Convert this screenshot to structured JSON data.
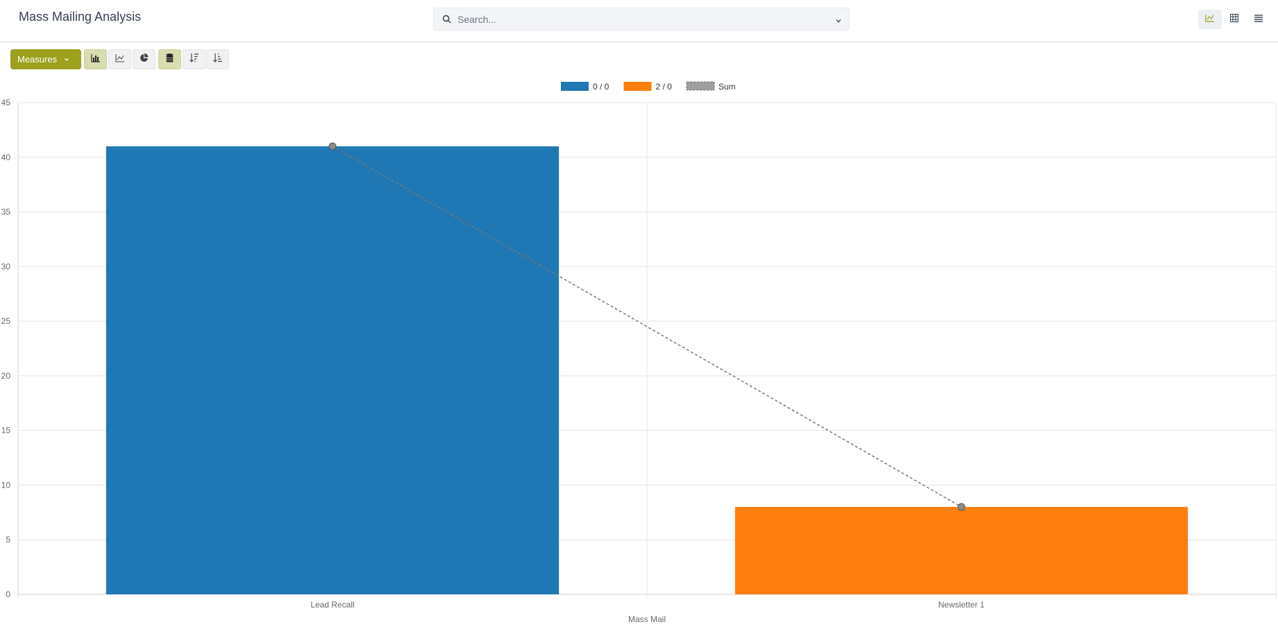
{
  "header": {
    "title": "Mass Mailing Analysis",
    "search_placeholder": "Search..."
  },
  "toolbar": {
    "measures_label": "Measures",
    "accent_color": "#9ca01b"
  },
  "chart_data": {
    "type": "bar",
    "categories": [
      "Lead Recall",
      "Newsletter 1"
    ],
    "series": [
      {
        "name": "0 / 0",
        "color": "#1f77b4",
        "values": [
          41,
          null
        ]
      },
      {
        "name": "2 / 0",
        "color": "#ff7f0e",
        "values": [
          null,
          8
        ]
      }
    ],
    "sum_line": {
      "name": "Sum",
      "values": [
        41,
        8
      ],
      "color": "#888888"
    },
    "xlabel": "Mass Mail",
    "ylabel": "",
    "ylim": [
      0,
      45
    ],
    "yticks": [
      0,
      5,
      10,
      15,
      20,
      25,
      30,
      35,
      40,
      45
    ],
    "grid": true,
    "legend_position": "top-center",
    "stacked": true
  }
}
